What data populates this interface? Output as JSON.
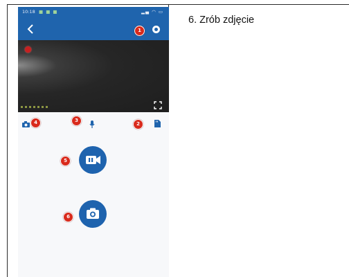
{
  "step": {
    "text": "6. Zrób zdjęcie"
  },
  "status_bar": {
    "time": "10:18"
  },
  "icons": {
    "back": "back-arrow-icon",
    "settings": "settings-icon",
    "recording": "recording-dot-icon",
    "fullscreen": "fullscreen-icon",
    "snapshot": "camera-small-icon",
    "microphone": "microphone-icon",
    "storage": "sd-card-icon",
    "record": "video-camera-icon",
    "photo": "photo-camera-icon"
  },
  "markers": [
    "1",
    "2",
    "3",
    "4",
    "5",
    "6"
  ],
  "colors": {
    "header": "#1f64ad",
    "button": "#1e63ae",
    "marker": "#d92a1c",
    "video_bg": "#1e1e1e"
  }
}
